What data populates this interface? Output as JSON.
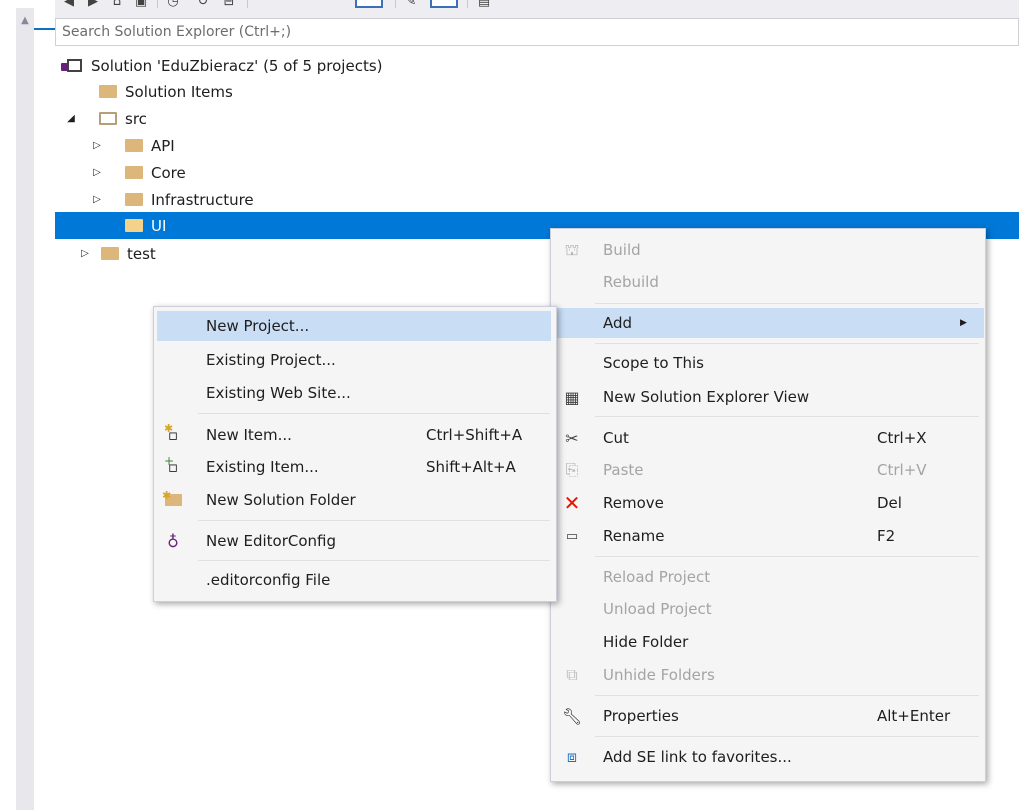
{
  "search": {
    "placeholder": "Search Solution Explorer (Ctrl+;)"
  },
  "tree": {
    "solution_label": "Solution 'EduZbieracz' (5 of 5 projects)",
    "items": [
      {
        "label": "Solution Items"
      },
      {
        "label": "src"
      },
      {
        "label": "API"
      },
      {
        "label": "Core"
      },
      {
        "label": "Infrastructure"
      },
      {
        "label": "UI"
      },
      {
        "label": "test"
      }
    ]
  },
  "context_menu": {
    "items": [
      {
        "label": "Build",
        "shortcut": "",
        "icon": "build-icon"
      },
      {
        "label": "Rebuild",
        "shortcut": ""
      },
      {
        "label": "Add",
        "shortcut": ""
      },
      {
        "label": "Scope to This",
        "shortcut": ""
      },
      {
        "label": "New Solution Explorer View",
        "shortcut": "",
        "icon": "new-view-icon"
      },
      {
        "label": "Cut",
        "shortcut": "Ctrl+X",
        "icon": "scissors-icon"
      },
      {
        "label": "Paste",
        "shortcut": "Ctrl+V",
        "icon": "paste-icon"
      },
      {
        "label": "Remove",
        "shortcut": "Del",
        "icon": "remove-x-icon"
      },
      {
        "label": "Rename",
        "shortcut": "F2",
        "icon": "rename-icon"
      },
      {
        "label": "Reload Project",
        "shortcut": ""
      },
      {
        "label": "Unload Project",
        "shortcut": ""
      },
      {
        "label": "Hide Folder",
        "shortcut": ""
      },
      {
        "label": "Unhide Folders",
        "shortcut": "",
        "icon": "unhide-icon"
      },
      {
        "label": "Properties",
        "shortcut": "Alt+Enter",
        "icon": "wrench-icon"
      },
      {
        "label": "Add SE link to favorites...",
        "shortcut": "",
        "icon": "favorites-link-icon"
      }
    ]
  },
  "add_submenu": {
    "items": [
      {
        "label": "New Project...",
        "shortcut": ""
      },
      {
        "label": "Existing Project...",
        "shortcut": ""
      },
      {
        "label": "Existing Web Site...",
        "shortcut": ""
      },
      {
        "label": "New Item...",
        "shortcut": "Ctrl+Shift+A",
        "icon": "new-item-icon"
      },
      {
        "label": "Existing Item...",
        "shortcut": "Shift+Alt+A",
        "icon": "existing-item-icon"
      },
      {
        "label": "New Solution Folder",
        "shortcut": "",
        "icon": "new-folder-icon"
      },
      {
        "label": "New EditorConfig",
        "shortcut": "",
        "icon": "lightbulb-icon"
      },
      {
        "label": ".editorconfig File",
        "shortcut": ""
      }
    ]
  },
  "colors": {
    "selection": "#0078d7",
    "menu_highlight": "#c9def5",
    "menu_bg": "#f5f5f5",
    "disabled_text": "#a2a4a5",
    "remove_red": "#e51400"
  }
}
